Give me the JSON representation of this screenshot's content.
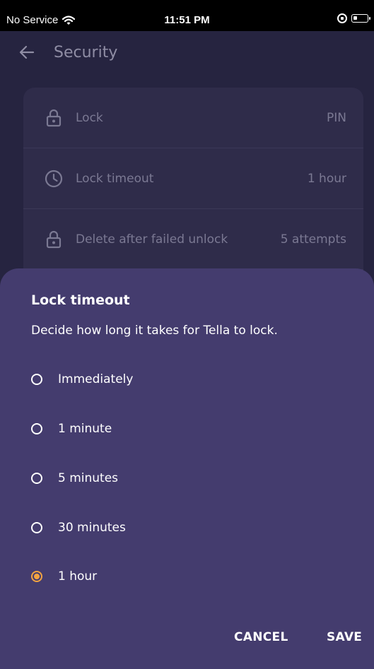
{
  "status_bar": {
    "carrier": "No Service",
    "time": "11:51 PM"
  },
  "header": {
    "title": "Security"
  },
  "settings": [
    {
      "label": "Lock",
      "value": "PIN",
      "icon": "lock-icon"
    },
    {
      "label": "Lock timeout",
      "value": "1 hour",
      "icon": "clock-icon"
    },
    {
      "label": "Delete after failed unlock",
      "value": "5 attempts",
      "icon": "lock-icon"
    }
  ],
  "dialog": {
    "title": "Lock timeout",
    "description": "Decide how long it takes for Tella to lock.",
    "options": [
      {
        "label": "Immediately",
        "selected": false
      },
      {
        "label": "1 minute",
        "selected": false
      },
      {
        "label": "5 minutes",
        "selected": false
      },
      {
        "label": "30 minutes",
        "selected": false
      },
      {
        "label": "1 hour",
        "selected": true
      }
    ],
    "cancel_label": "CANCEL",
    "save_label": "SAVE"
  },
  "colors": {
    "background": "#262440",
    "card": "#2f2c4a",
    "sheet": "#443c6e",
    "accent": "#f2a341"
  }
}
